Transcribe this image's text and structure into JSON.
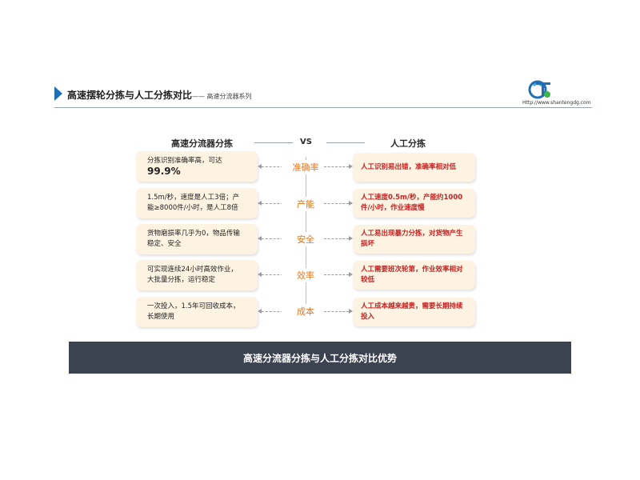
{
  "header": {
    "title": "高速摆轮分拣与人工分拣对比",
    "subtitle": "—— 高速分流器系列",
    "logo_url": "Http://www.shantengdg.com"
  },
  "columns": {
    "left_heading": "高速分流器分拣",
    "vs": "VS",
    "right_heading": "人工分拣"
  },
  "rows": [
    {
      "label": "准确率",
      "left_line1": "分拣识别准确率高，可达",
      "left_line2": "99.9%",
      "right_line1": "人工识别易出错，准确率相对低",
      "right_line2": ""
    },
    {
      "label": "产能",
      "left_line1": "1.5m/秒，速度是人工3倍；产",
      "left_line2": "能≥8000件/小时，是人工8倍",
      "right_line1": "人工速度0.5m/秒，产能约1000",
      "right_line2": "件/小时，作业速度慢"
    },
    {
      "label": "安全",
      "left_line1": "货物磨损率几乎为0，物品传输",
      "left_line2": "稳定、安全",
      "right_line1": "人工易出现暴力分拣，对货物产生",
      "right_line2": "损坏"
    },
    {
      "label": "效率",
      "left_line1": "可实现连续24小时高效作业，",
      "left_line2": "大批量分拣，运行稳定",
      "right_line1": "人工需要班次轮第，作业效率相对",
      "right_line2": "较低"
    },
    {
      "label": "成本",
      "left_line1": "一次投入，1.5年可回收成本，",
      "left_line2": "长期使用",
      "right_line1": "人工成本越来越贵，需要长期持续",
      "right_line2": "投入"
    }
  ],
  "banner": {
    "text": "高速分流器分拣与人工分拣对比优势"
  },
  "colors": {
    "accent": "#1f6fb5",
    "label_orange": "#e8751a",
    "right_text_red": "#c62020",
    "box_bg": "#fdf3e2",
    "banner_bg": "#3b4250"
  }
}
